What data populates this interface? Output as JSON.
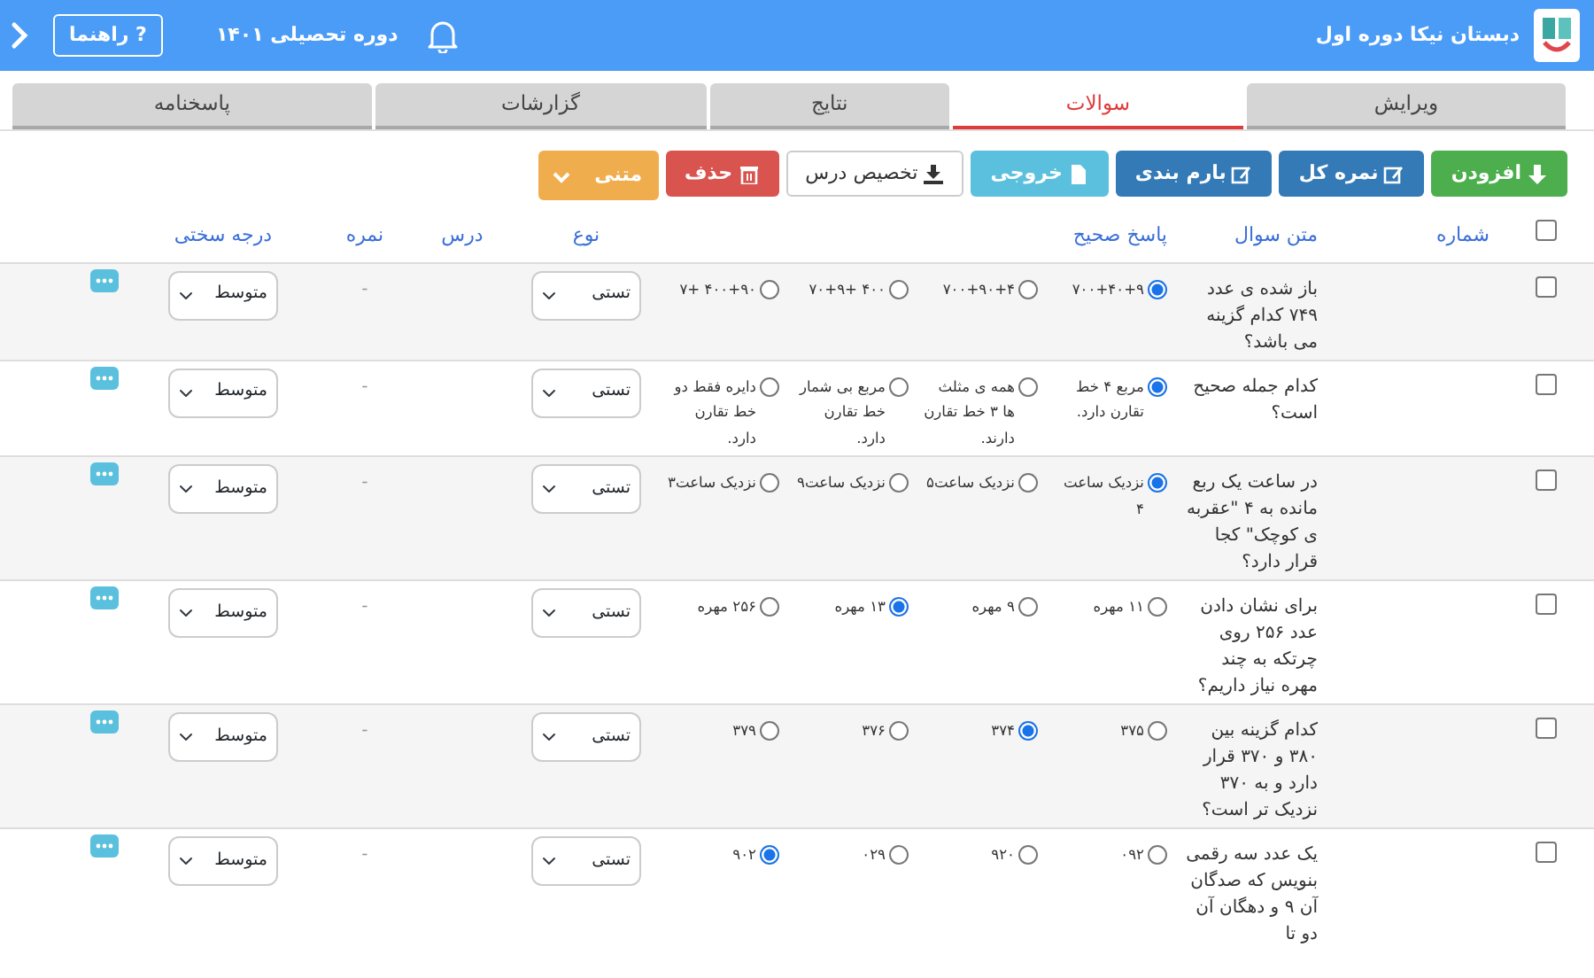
{
  "header": {
    "school_name": "دبستان نیکا دوره اول",
    "year_label": "دوره تحصیلی ۱۴۰۱",
    "help_button": "? راهنما"
  },
  "tabs": [
    {
      "label": "ویرایش",
      "selected": false
    },
    {
      "label": "سوالات",
      "selected": true
    },
    {
      "label": "نتایج",
      "selected": false
    },
    {
      "label": "گزارشات",
      "selected": false
    },
    {
      "label": "پاسخنامه",
      "selected": false
    }
  ],
  "toolbar": [
    {
      "label": "افزودن",
      "kind": "add"
    },
    {
      "label": "نمره کل",
      "kind": "edit"
    },
    {
      "label": "بارم بندی",
      "kind": "edit"
    },
    {
      "label": "خروجی",
      "kind": "export"
    },
    {
      "label": "تخصیص درس",
      "kind": "assign"
    },
    {
      "label": "حذف",
      "kind": "delete"
    },
    {
      "label": "متنی",
      "kind": "menu"
    }
  ],
  "all_checked": false,
  "columns": [
    "شماره",
    "متن سوال",
    "پاسخ صحیح",
    "نوع",
    "درس",
    "نمره",
    "درجه سختی"
  ],
  "rows": [
    {
      "checked": false,
      "question": "باز شده ی عدد ۷۴۹ کدام گزینه می باشد؟",
      "options": [
        {
          "text": "۷۰۰+۴۰+۹",
          "selected": true
        },
        {
          "text": "۷۰۰+۹۰+۴",
          "selected": false
        },
        {
          "text": "۴۰۰ +۷۰+۹",
          "selected": false
        },
        {
          "text": "۴۰۰+۹۰ +۷",
          "selected": false
        }
      ],
      "type": "تستی",
      "score": "-",
      "difficulty": "متوسط"
    },
    {
      "checked": false,
      "question": "کدام جمله صحیح است؟",
      "options": [
        {
          "text": "مربع ۴ خط تقارن دارد.",
          "selected": true
        },
        {
          "text": "همه ی مثلث ها ۳ خط تقارن دارند.",
          "selected": false
        },
        {
          "text": "مربع بی شمار خط تقارن دارد.",
          "selected": false
        },
        {
          "text": "دایره فقط دو خط تقارن دارد.",
          "selected": false
        }
      ],
      "type": "تستی",
      "score": "-",
      "difficulty": "متوسط"
    },
    {
      "checked": false,
      "question": "در ساعت یک ربع مانده به ۴ \"عقربه ی کوچک\" کجا قرار دارد؟",
      "options": [
        {
          "text": "نزدیک ساعت ۴",
          "selected": true
        },
        {
          "text": "نزدیک ساعت۵",
          "selected": false
        },
        {
          "text": "نزدیک ساعت۹",
          "selected": false
        },
        {
          "text": "نزدیک ساعت۳",
          "selected": false
        }
      ],
      "type": "تستی",
      "score": "-",
      "difficulty": "متوسط"
    },
    {
      "checked": false,
      "question": "برای نشان دادن عدد ۲۵۶ روی چرتکه به چند مهره نیاز داریم؟",
      "options": [
        {
          "text": "۱۱ مهره",
          "selected": false
        },
        {
          "text": "۹ مهره",
          "selected": false
        },
        {
          "text": "۱۳ مهره",
          "selected": true
        },
        {
          "text": "۲۵۶ مهره",
          "selected": false
        }
      ],
      "type": "تستی",
      "score": "-",
      "difficulty": "متوسط"
    },
    {
      "checked": false,
      "question": "کدام گزینه بین ۳۸۰ و ۳۷۰ قرار دارد و به ۳۷۰ نزدیک تر است؟",
      "options": [
        {
          "text": "۳۷۵",
          "selected": false
        },
        {
          "text": "۳۷۴",
          "selected": true
        },
        {
          "text": "۳۷۶",
          "selected": false
        },
        {
          "text": "۳۷۹",
          "selected": false
        }
      ],
      "type": "تستی",
      "score": "-",
      "difficulty": "متوسط"
    },
    {
      "checked": false,
      "question": "یک عدد سه رقمی بنویس که صدگان آن ۹ و دهگان آن دو تا",
      "options": [
        {
          "text": "۰۹۲",
          "selected": false
        },
        {
          "text": "۹۲۰",
          "selected": false
        },
        {
          "text": "۰۲۹",
          "selected": false
        },
        {
          "text": "۹۰۲",
          "selected": true
        }
      ],
      "type": "تستی",
      "score": "-",
      "difficulty": "متوسط"
    }
  ]
}
